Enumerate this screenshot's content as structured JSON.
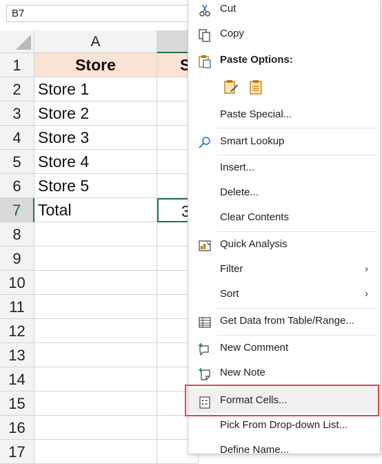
{
  "name_box": "B7",
  "columns": [
    "A",
    "S"
  ],
  "rows": [
    "1",
    "2",
    "3",
    "4",
    "5",
    "6",
    "7",
    "8",
    "9",
    "10",
    "11",
    "12",
    "13",
    "14",
    "15",
    "16",
    "17"
  ],
  "cells": {
    "a1": "Store",
    "b1": "S",
    "a2": "Store 1",
    "a3": "Store 2",
    "a4": "Store 3",
    "a5": "Store 4",
    "a6": "Store 5",
    "a7": "Total",
    "b7": "3"
  },
  "menu": {
    "cut": "Cut",
    "copy": "Copy",
    "paste_options": "Paste Options:",
    "paste_special": "Paste Special...",
    "smart_lookup": "Smart Lookup",
    "insert": "Insert...",
    "delete": "Delete...",
    "clear_contents": "Clear Contents",
    "quick_analysis": "Quick Analysis",
    "filter": "Filter",
    "sort": "Sort",
    "get_data": "Get Data from Table/Range...",
    "new_comment": "New Comment",
    "new_note": "New Note",
    "format_cells": "Format Cells...",
    "pick_from_list": "Pick From Drop-down List...",
    "define_name": "Define Name...",
    "submenu_arrow": "›"
  },
  "colors": {
    "accent_green": "#217346",
    "header_fill": "#fbe2d5",
    "highlight_red": "#e0454f"
  }
}
